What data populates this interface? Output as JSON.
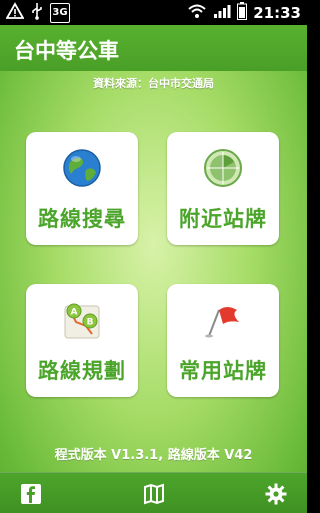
{
  "statusbar": {
    "network_badge": "3G",
    "time": "21:33",
    "icons": [
      "warning-icon",
      "usb-icon",
      "3g-icon",
      "wifi-icon",
      "signal-icon",
      "battery-icon"
    ]
  },
  "app": {
    "title": "台中等公車",
    "data_source": "資料來源：台中市交通局",
    "tiles": [
      {
        "label": "路線搜尋",
        "icon": "globe-icon"
      },
      {
        "label": "附近站牌",
        "icon": "radar-icon"
      },
      {
        "label": "路線規劃",
        "icon": "route-map-icon"
      },
      {
        "label": "常用站牌",
        "icon": "flag-icon"
      }
    ],
    "version_text": "程式版本 V1.3.1, 路線版本 V42",
    "bottom_icons": [
      "facebook-icon",
      "map-icon",
      "gear-icon"
    ]
  },
  "colors": {
    "brand_green": "#4ca52b",
    "titlebar_green": "#58b12f"
  }
}
